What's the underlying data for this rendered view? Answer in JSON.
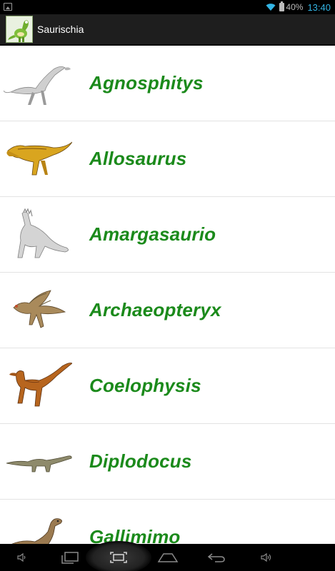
{
  "status_bar": {
    "battery_percent": "40%",
    "time": "13:40",
    "icons": [
      "image-notification-icon",
      "wifi-icon",
      "battery-icon"
    ]
  },
  "action_bar": {
    "title": "Saurischia",
    "app_icon": "dinosaur-app-icon"
  },
  "list": {
    "items": [
      {
        "label": "Agnosphitys",
        "thumb": "agnosphitys-thumbnail"
      },
      {
        "label": "Allosaurus",
        "thumb": "allosaurus-thumbnail"
      },
      {
        "label": "Amargasaurio",
        "thumb": "amargasaurio-thumbnail"
      },
      {
        "label": "Archaeopteryx",
        "thumb": "archaeopteryx-thumbnail"
      },
      {
        "label": "Coelophysis",
        "thumb": "coelophysis-thumbnail"
      },
      {
        "label": "Diplodocus",
        "thumb": "diplodocus-thumbnail"
      },
      {
        "label": "Gallimimo",
        "thumb": "gallimimo-thumbnail"
      }
    ]
  },
  "nav_bar": {
    "buttons": [
      "volume-down-icon",
      "recent-apps-icon",
      "screenshot-icon",
      "home-icon",
      "back-icon",
      "volume-up-icon"
    ]
  },
  "colors": {
    "label_green": "#1b8a1b",
    "status_blue": "#33b5e5",
    "action_bar_bg": "#1e1e1e"
  }
}
